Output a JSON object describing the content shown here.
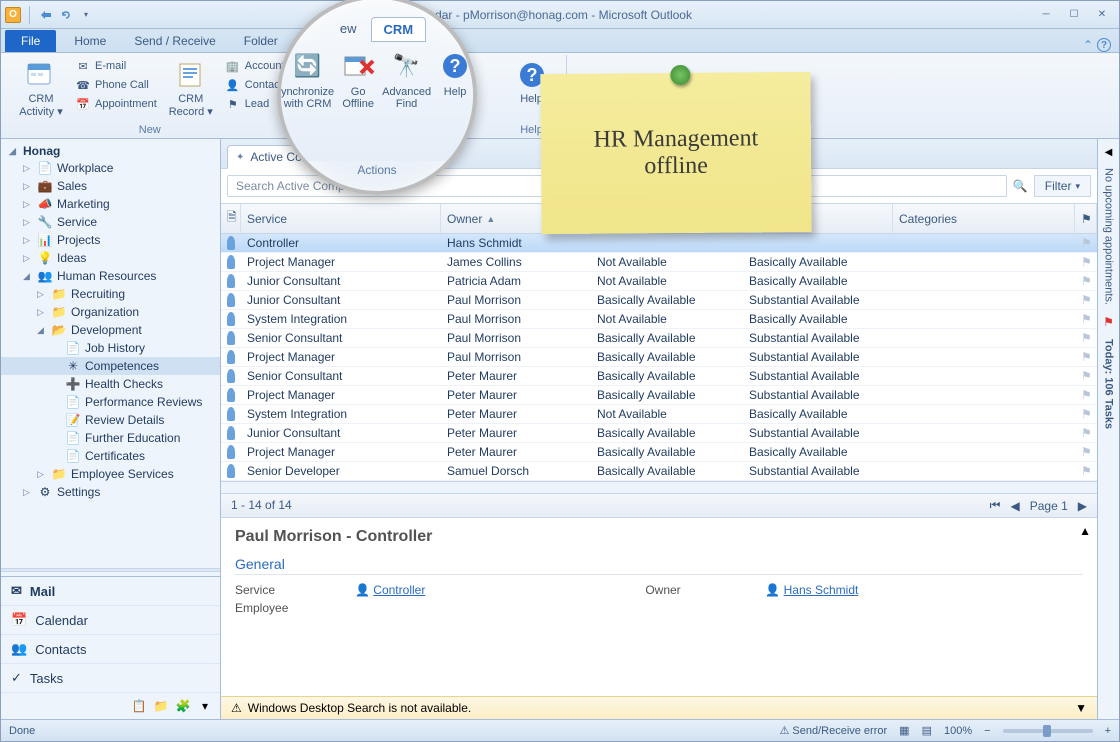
{
  "window": {
    "title_suffix": "dar - pMorrison@honag.com - Microsoft Outlook"
  },
  "ribbon": {
    "tabs": [
      "File",
      "Home",
      "Send / Receive",
      "Folder",
      "ew",
      "CRM"
    ],
    "active_index": 5,
    "groups": {
      "new": {
        "title": "New",
        "big": {
          "label": "CRM\nActivity",
          "drop": "▾"
        },
        "smalls": [
          "E-mail",
          "Phone Call",
          "Appointment"
        ]
      },
      "records": {
        "big": {
          "label": "CRM\nRecord",
          "drop": "▾"
        },
        "smalls": [
          "Account",
          "Contact",
          "Lead"
        ]
      },
      "help": {
        "title": "Help",
        "label": "Help"
      }
    }
  },
  "magnifier": {
    "tabs": [
      "ew",
      "CRM"
    ],
    "actions": [
      {
        "label": "ynchronize\nwith CRM"
      },
      {
        "label": "Go\nOffline"
      },
      {
        "label": "Advanced\nFind"
      }
    ],
    "help": "Help",
    "group_title": "Actions"
  },
  "sticky": "HR Management\noffline",
  "nav": {
    "root": "Honag",
    "items": [
      {
        "label": "Workplace",
        "indent": 1
      },
      {
        "label": "Sales",
        "indent": 1
      },
      {
        "label": "Marketing",
        "indent": 1
      },
      {
        "label": "Service",
        "indent": 1
      },
      {
        "label": "Projects",
        "indent": 1
      },
      {
        "label": "Ideas",
        "indent": 1
      },
      {
        "label": "Human Resources",
        "indent": 1,
        "expanded": true
      },
      {
        "label": "Recruiting",
        "indent": 2
      },
      {
        "label": "Organization",
        "indent": 2
      },
      {
        "label": "Development",
        "indent": 2,
        "expanded": true
      },
      {
        "label": "Job History",
        "indent": 3
      },
      {
        "label": "Competences",
        "indent": 3,
        "selected": true
      },
      {
        "label": "Health Checks",
        "indent": 3
      },
      {
        "label": "Performance Reviews",
        "indent": 3
      },
      {
        "label": "Review Details",
        "indent": 3
      },
      {
        "label": "Further Education",
        "indent": 3
      },
      {
        "label": "Certificates",
        "indent": 3
      },
      {
        "label": "Employee Services",
        "indent": 2
      },
      {
        "label": "Settings",
        "indent": 1
      }
    ],
    "buttons": [
      "Mail",
      "Calendar",
      "Contacts",
      "Tasks"
    ]
  },
  "view": {
    "tab_label": "Active Competences",
    "search_placeholder": "Search Active Competences",
    "filter_label": "Filter"
  },
  "grid": {
    "headers": [
      "Service",
      "Owner",
      "",
      "",
      "Categories"
    ],
    "owner_sort": "▲",
    "rows": [
      {
        "service": "Controller",
        "owner": "Hans Schmidt",
        "a1": "",
        "a2": "",
        "selected": true
      },
      {
        "service": "Project Manager",
        "owner": "James Collins",
        "a1": "Not Available",
        "a2": "Basically Available"
      },
      {
        "service": "Junior Consultant",
        "owner": "Patricia Adam",
        "a1": "Not Available",
        "a2": "Basically Available"
      },
      {
        "service": "Junior Consultant",
        "owner": "Paul Morrison",
        "a1": "Basically Available",
        "a2": "Substantial Available"
      },
      {
        "service": "System Integration",
        "owner": "Paul Morrison",
        "a1": "Not Available",
        "a2": "Basically Available"
      },
      {
        "service": "Senior Consultant",
        "owner": "Paul Morrison",
        "a1": "Basically Available",
        "a2": "Substantial Available"
      },
      {
        "service": "Project Manager",
        "owner": "Paul Morrison",
        "a1": "Basically Available",
        "a2": "Substantial Available"
      },
      {
        "service": "Senior Consultant",
        "owner": "Peter Maurer",
        "a1": "Basically Available",
        "a2": "Substantial Available"
      },
      {
        "service": "Project Manager",
        "owner": "Peter Maurer",
        "a1": "Basically Available",
        "a2": "Substantial Available"
      },
      {
        "service": "System Integration",
        "owner": "Peter Maurer",
        "a1": "Not Available",
        "a2": "Basically Available"
      },
      {
        "service": "Junior Consultant",
        "owner": "Peter Maurer",
        "a1": "Basically Available",
        "a2": "Substantial Available"
      },
      {
        "service": "Project Manager",
        "owner": "Peter Maurer",
        "a1": "Basically Available",
        "a2": "Basically Available"
      },
      {
        "service": "Senior Developer",
        "owner": "Samuel Dorsch",
        "a1": "Basically Available",
        "a2": "Substantial Available"
      }
    ],
    "pager_left": "1 - 14 of 14",
    "pager_right": "Page 1"
  },
  "preview": {
    "title": "Paul Morrison - Controller",
    "section": "General",
    "rows": [
      {
        "label": "Service",
        "link": "Controller",
        "label2": "Owner",
        "link2": "Hans Schmidt"
      },
      {
        "label": "Employee",
        "link": "",
        "label2": "",
        "link2": ""
      }
    ],
    "wds": "Windows Desktop Search is not available."
  },
  "sidebar_right": {
    "line1": "No upcoming appointments.",
    "line2": "Today: 106 Tasks"
  },
  "statusbar": {
    "left": "Done",
    "error": "Send/Receive error",
    "zoom": "100%"
  }
}
